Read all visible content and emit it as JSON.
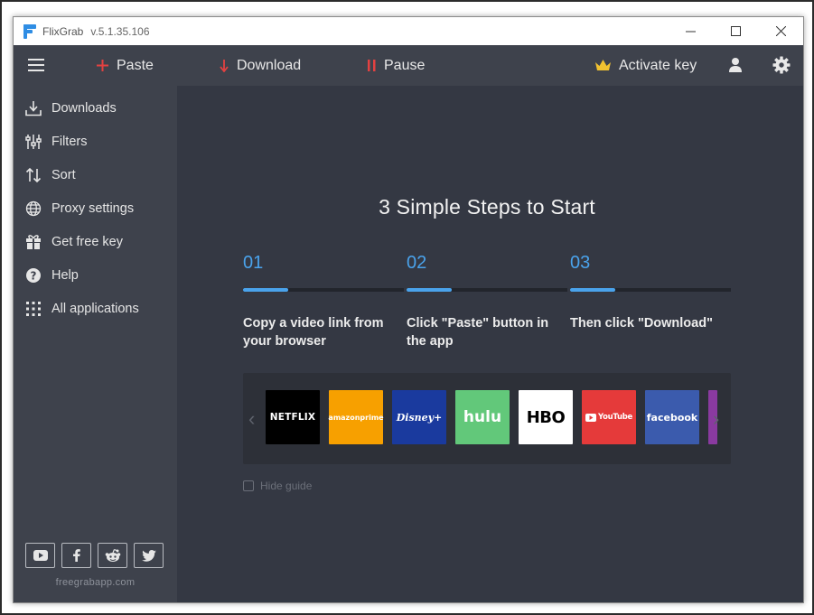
{
  "window": {
    "title": "FlixGrab",
    "version": "v.5.1.35.106"
  },
  "toolbar": {
    "paste_label": "Paste",
    "download_label": "Download",
    "pause_label": "Pause",
    "activate_label": "Activate key"
  },
  "sidebar": {
    "items": [
      {
        "label": "Downloads",
        "icon": "download-tray-icon"
      },
      {
        "label": "Filters",
        "icon": "filters-sliders-icon"
      },
      {
        "label": "Sort",
        "icon": "sort-arrows-icon"
      },
      {
        "label": "Proxy settings",
        "icon": "globe-icon"
      },
      {
        "label": "Get free key",
        "icon": "gift-icon"
      },
      {
        "label": "Help",
        "icon": "help-icon"
      },
      {
        "label": "All applications",
        "icon": "grid-dots-icon"
      }
    ],
    "social": [
      "youtube-icon",
      "facebook-icon",
      "reddit-icon",
      "twitter-icon"
    ],
    "site": "freegrabapp.com"
  },
  "main": {
    "headline": "3 Simple Steps to Start",
    "steps": [
      {
        "num": "01",
        "text": "Copy a video link from your browser"
      },
      {
        "num": "02",
        "text": "Click \"Paste\" button in the app"
      },
      {
        "num": "03",
        "text": "Then click \"Download\""
      }
    ],
    "services": [
      {
        "name": "NETFLIX",
        "bg": "#000000",
        "fg": "#ffffff"
      },
      {
        "name": "amazonprime",
        "bg": "#f7a000",
        "fg": "#ffffff"
      },
      {
        "name": "Disney+",
        "bg": "#1a3a9e",
        "fg": "#ffffff"
      },
      {
        "name": "hulu",
        "bg": "#62c87a",
        "fg": "#ffffff"
      },
      {
        "name": "HBO",
        "bg": "#ffffff",
        "fg": "#000000"
      },
      {
        "name": "YouTube",
        "bg": "#e53a3a",
        "fg": "#ffffff"
      },
      {
        "name": "facebook",
        "bg": "#3b5bad",
        "fg": "#ffffff"
      }
    ],
    "hide_guide": "Hide guide"
  },
  "colors": {
    "accent": "#4aa3ec",
    "paste_download_pause": "#e34141",
    "crown": "#f2c230",
    "sidebar_bg": "#3e424c",
    "main_bg": "#343843"
  }
}
